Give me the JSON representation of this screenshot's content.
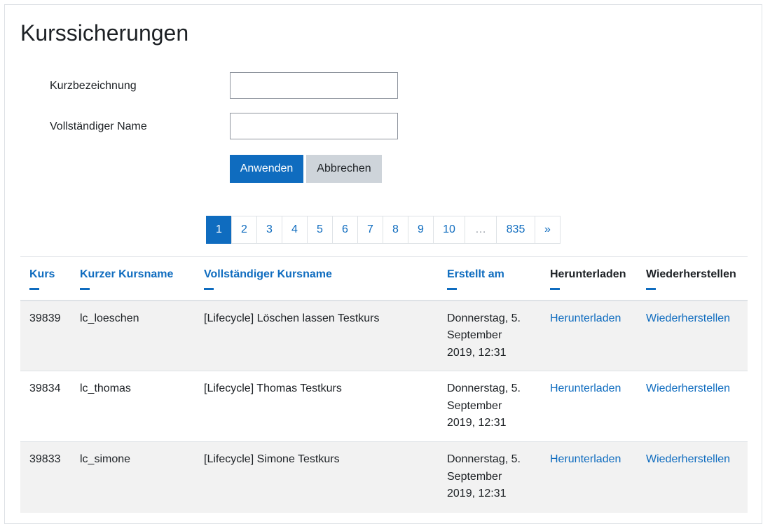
{
  "page": {
    "title": "Kurssicherungen"
  },
  "form": {
    "shortname_label": "Kurzbezeichnung",
    "shortname_value": "",
    "fullname_label": "Vollständiger Name",
    "fullname_value": "",
    "apply_label": "Anwenden",
    "cancel_label": "Abbrechen"
  },
  "pagination": {
    "items": [
      "1",
      "2",
      "3",
      "4",
      "5",
      "6",
      "7",
      "8",
      "9",
      "10",
      "…",
      "835",
      "»"
    ],
    "active": "1"
  },
  "table": {
    "headers": {
      "course": "Kurs",
      "shortname": "Kurzer Kursname",
      "fullname": "Vollständiger Kursname",
      "created": "Erstellt am",
      "download": "Herunterladen",
      "restore": "Wiederherstellen"
    },
    "rows": [
      {
        "course": "39839",
        "shortname": "lc_loeschen",
        "fullname": "[Lifecycle] Löschen lassen Testkurs",
        "created": "Donnerstag, 5. September 2019, 12:31",
        "download": "Herunterladen",
        "restore": "Wiederherstellen"
      },
      {
        "course": "39834",
        "shortname": "lc_thomas",
        "fullname": "[Lifecycle] Thomas Testkurs",
        "created": "Donnerstag, 5. September 2019, 12:31",
        "download": "Herunterladen",
        "restore": "Wiederherstellen"
      },
      {
        "course": "39833",
        "shortname": "lc_simone",
        "fullname": "[Lifecycle] Simone Testkurs",
        "created": "Donnerstag, 5. September 2019, 12:31",
        "download": "Herunterladen",
        "restore": "Wiederherstellen"
      }
    ]
  },
  "colors": {
    "link": "#0f6cbf",
    "primary": "#0f6cbf",
    "secondary": "#ced4da",
    "row_stripe": "#f2f2f2"
  }
}
